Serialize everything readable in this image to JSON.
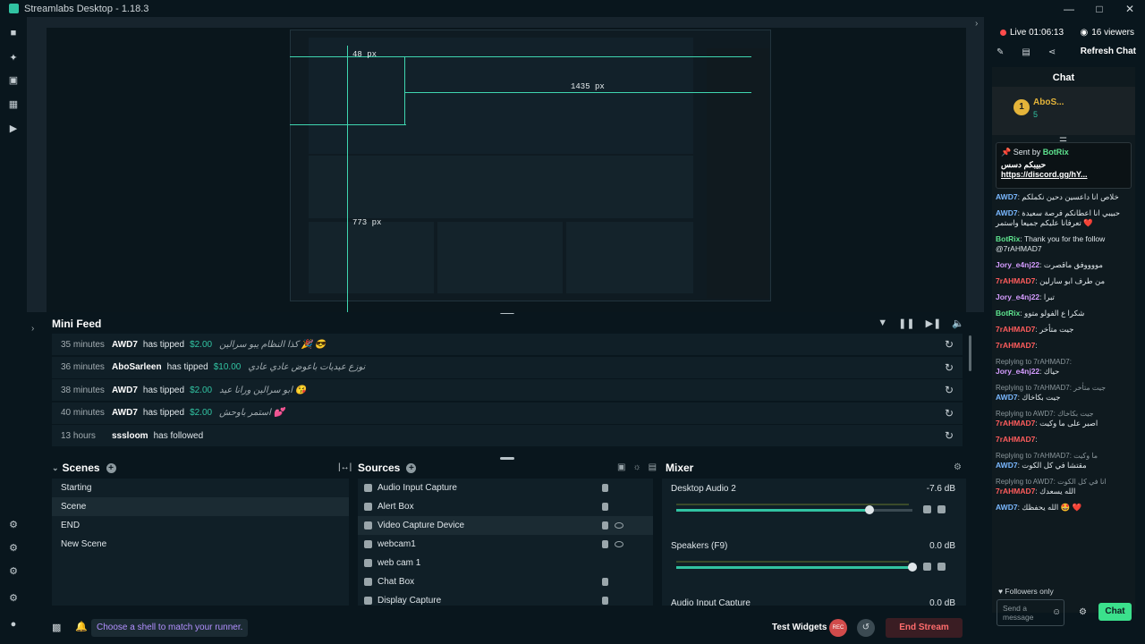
{
  "window": {
    "title": "Streamlabs Desktop - 1.18.3"
  },
  "preview": {
    "measure_top": "48 px",
    "measure_right": "1435 px",
    "measure_bottom": "773 px"
  },
  "minifeed": {
    "title": "Mini Feed",
    "rows": [
      {
        "time": "35 minutes",
        "user": "AWD7",
        "verb": "has tipped",
        "amount": "$2.00",
        "message": "كذا النظام يبو سرالين 🎉 😎"
      },
      {
        "time": "36 minutes",
        "user": "AboSarleen",
        "verb": "has tipped",
        "amount": "$10.00",
        "message": "نوزع عيديات باعوض عادي عادي"
      },
      {
        "time": "38 minutes",
        "user": "AWD7",
        "verb": "has tipped",
        "amount": "$2.00",
        "message": "ابو سرالين ورانا عيد 😘"
      },
      {
        "time": "40 minutes",
        "user": "AWD7",
        "verb": "has tipped",
        "amount": "$2.00",
        "message": "استمر باوحش 💕"
      },
      {
        "time": "13 hours",
        "user": "sssloom",
        "verb": "has followed",
        "amount": "",
        "message": ""
      }
    ]
  },
  "scenes": {
    "title": "Scenes",
    "items": [
      "Starting",
      "Scene",
      "END",
      "New Scene"
    ]
  },
  "sources": {
    "title": "Sources",
    "items": [
      "Audio Input Capture",
      "Alert Box",
      "Video Capture Device",
      "webcam1",
      "web cam 1",
      "Chat Box",
      "Display Capture"
    ]
  },
  "mixer": {
    "title": "Mixer",
    "channels": [
      {
        "name": "Desktop Audio 2",
        "db": "-7.6 dB",
        "level": 0.82
      },
      {
        "name": "Speakers (F9)",
        "db": "0.0 dB",
        "level": 1.0
      },
      {
        "name": "Audio Input Capture",
        "db": "0.0 dB",
        "level": 1.0
      }
    ]
  },
  "statusbar": {
    "hint": "Choose a shell to match your runner.",
    "test_widgets": "Test Widgets",
    "rec": "REC",
    "end_stream": "End Stream"
  },
  "chat": {
    "live": "Live 01:06:13",
    "viewers": "16 viewers",
    "refresh": "Refresh Chat",
    "title": "Chat",
    "leader": {
      "rank": "1",
      "name": "AboS...",
      "count": "5"
    },
    "pinned": {
      "sent_by": "Sent by",
      "bot": "BotRix",
      "text": "حبيبكم دسس",
      "link": "https://discord.gg/hY..."
    },
    "messages": [
      {
        "reply": "",
        "user": "AWD7",
        "text": "خلاص انا داعسين دحين نكملكم",
        "cls": "u-awd"
      },
      {
        "reply": "",
        "user": "AWD7",
        "text": "حبيبي انا اعطانكم فرصة سعيدة تعرفانا عليكم جميعا واستمر ❤️",
        "cls": "u-awd"
      },
      {
        "reply": "",
        "user": "BotRix",
        "text": "Thank you for the follow @7rAHMAD7",
        "cls": "u-bot"
      },
      {
        "reply": "",
        "user": "Jory_e4nj22",
        "text": "مووووفق ماقصرت",
        "cls": "u-jory"
      },
      {
        "reply": "",
        "user": "7rAHMAD7",
        "text": "من طرف ابو سارلين",
        "cls": "u-ahmad"
      },
      {
        "reply": "",
        "user": "Jory_e4nj22",
        "text": "تبرا",
        "cls": "u-jory"
      },
      {
        "reply": "",
        "user": "BotRix",
        "text": "شكرا ع الفولو متوو",
        "cls": "u-bot"
      },
      {
        "reply": "",
        "user": "7rAHMAD7",
        "text": "جيت متأخر",
        "cls": "u-ahmad"
      },
      {
        "reply": "",
        "user": "7rAHMAD7",
        "text": "",
        "cls": "u-ahmad"
      },
      {
        "reply": "Replying to 7rAHMAD7:",
        "user": "Jory_e4nj22",
        "text": "حياك",
        "cls": "u-jory"
      },
      {
        "reply": "Replying to 7rAHMAD7: جيت متأخر",
        "user": "AWD7",
        "text": "جيت بكاخاك",
        "cls": "u-awd"
      },
      {
        "reply": "Replying to AWD7: جيت بكاخاك",
        "user": "7rAHMAD7",
        "text": "اصبر على ما وكيت",
        "cls": "u-ahmad"
      },
      {
        "reply": "",
        "user": "7rAHMAD7",
        "text": "",
        "cls": "u-ahmad"
      },
      {
        "reply": "Replying to 7rAHMAD7: ما وكيت",
        "user": "AWD7",
        "text": "مقتشا في كل الكوت",
        "cls": "u-awd"
      },
      {
        "reply": "Replying to AWD7: انا في كل الكوت",
        "user": "7rAHMAD7",
        "text": "الله يسعدك",
        "cls": "u-ahmad"
      },
      {
        "reply": "",
        "user": "AWD7",
        "text": "الله يحفظك 🤩 ❤️",
        "cls": "u-awd"
      }
    ],
    "followers_only": "Followers only",
    "send_placeholder": "Send a message",
    "chat_button": "Chat"
  }
}
